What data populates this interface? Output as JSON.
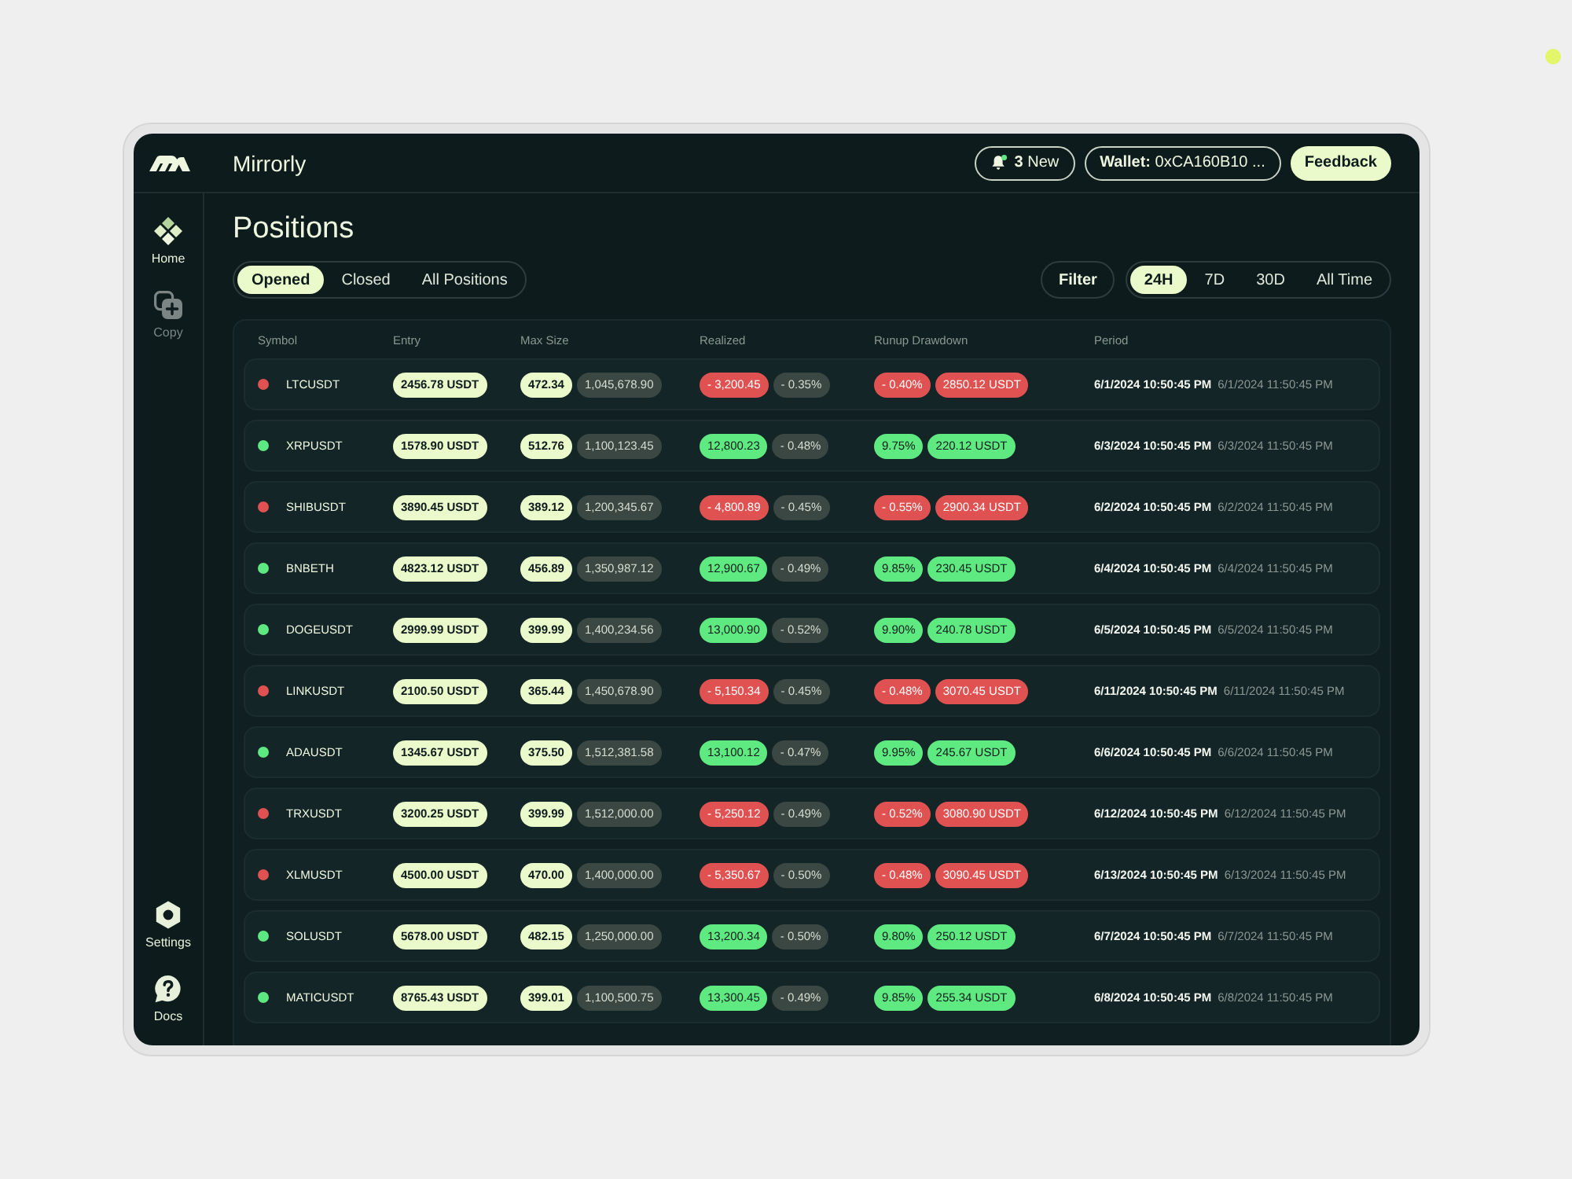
{
  "app": {
    "name": "Mirrorly"
  },
  "header": {
    "notifications": "**3** New",
    "wallet": "**Wallet:** 0xCA160B10 ...",
    "feedback": "Feedback"
  },
  "sidebar": {
    "items": [
      {
        "label": "Home",
        "disabled": false
      },
      {
        "label": "Copy",
        "disabled": true
      }
    ],
    "bottom_items": [
      {
        "label": "Settings",
        "disabled": false
      },
      {
        "label": "Docs",
        "disabled": false
      }
    ]
  },
  "page": {
    "title": "Positions"
  },
  "tabs": [
    {
      "label": "Opened",
      "selected": true
    },
    {
      "label": "Closed",
      "selected": false
    },
    {
      "label": "All Positions",
      "selected": false
    }
  ],
  "filter": "Filter",
  "ranges": [
    {
      "label": "24H",
      "selected": true
    },
    {
      "label": "7D",
      "selected": false
    },
    {
      "label": "30D",
      "selected": false
    },
    {
      "label": "All Time",
      "selected": false
    }
  ],
  "table": {
    "columns": [
      "Symbol",
      "Entry",
      "Max Size",
      "Realized",
      "Runup Drawdown",
      "Period"
    ],
    "rows": [
      {
        "symbol": "LTCUSDT",
        "color": "#e05252",
        "kind": "loss",
        "entry": "2456.78 USDT",
        "max_size": [
          "472.34",
          "1,045,678.90"
        ],
        "realized": [
          "- 3,200.45",
          "- 0.35%"
        ],
        "runup_drawdown": [
          "- 0.40%",
          "2850.12 USDT"
        ],
        "period": [
          "6/1/2024 10:50:45 PM",
          "6/1/2024 11:50:45 PM"
        ]
      },
      {
        "symbol": "XRPUSDT",
        "color": "#5ee882",
        "kind": "profit",
        "entry": "1578.90 USDT",
        "max_size": [
          "512.76",
          "1,100,123.45"
        ],
        "realized": [
          "12,800.23",
          "- 0.48%"
        ],
        "runup_drawdown": [
          "9.75%",
          "220.12 USDT"
        ],
        "period": [
          "6/3/2024 10:50:45 PM",
          "6/3/2024 11:50:45 PM"
        ]
      },
      {
        "symbol": "SHIBUSDT",
        "color": "#e05252",
        "kind": "loss",
        "entry": "3890.45 USDT",
        "max_size": [
          "389.12",
          "1,200,345.67"
        ],
        "realized": [
          "- 4,800.89",
          "- 0.45%"
        ],
        "runup_drawdown": [
          "- 0.55%",
          "2900.34 USDT"
        ],
        "period": [
          "6/2/2024 10:50:45 PM",
          "6/2/2024 11:50:45 PM"
        ]
      },
      {
        "symbol": "BNBETH",
        "color": "#5ee882",
        "kind": "profit",
        "entry": "4823.12 USDT",
        "max_size": [
          "456.89",
          "1,350,987.12"
        ],
        "realized": [
          "12,900.67",
          "- 0.49%"
        ],
        "runup_drawdown": [
          "9.85%",
          "230.45 USDT"
        ],
        "period": [
          "6/4/2024 10:50:45 PM",
          "6/4/2024 11:50:45 PM"
        ]
      },
      {
        "symbol": "DOGEUSDT",
        "color": "#5ee882",
        "kind": "profit",
        "entry": "2999.99 USDT",
        "max_size": [
          "399.99",
          "1,400,234.56"
        ],
        "realized": [
          "13,000.90",
          "- 0.52%"
        ],
        "runup_drawdown": [
          "9.90%",
          "240.78 USDT"
        ],
        "period": [
          "6/5/2024 10:50:45 PM",
          "6/5/2024 11:50:45 PM"
        ]
      },
      {
        "symbol": "LINKUSDT",
        "color": "#e05252",
        "kind": "loss",
        "entry": "2100.50 USDT",
        "max_size": [
          "365.44",
          "1,450,678.90"
        ],
        "realized": [
          "- 5,150.34",
          "- 0.45%"
        ],
        "runup_drawdown": [
          "- 0.48%",
          "3070.45 USDT"
        ],
        "period": [
          "6/11/2024 10:50:45 PM",
          "6/11/2024 11:50:45 PM"
        ]
      },
      {
        "symbol": "ADAUSDT",
        "color": "#5ee882",
        "kind": "profit",
        "entry": "1345.67 USDT",
        "max_size": [
          "375.50",
          "1,512,381.58"
        ],
        "realized": [
          "13,100.12",
          "- 0.47%"
        ],
        "runup_drawdown": [
          "9.95%",
          "245.67 USDT"
        ],
        "period": [
          "6/6/2024 10:50:45 PM",
          "6/6/2024 11:50:45 PM"
        ]
      },
      {
        "symbol": "TRXUSDT",
        "color": "#e05252",
        "kind": "loss",
        "entry": "3200.25 USDT",
        "max_size": [
          "399.99",
          "1,512,000.00"
        ],
        "realized": [
          "- 5,250.12",
          "- 0.49%"
        ],
        "runup_drawdown": [
          "- 0.52%",
          "3080.90 USDT"
        ],
        "period": [
          "6/12/2024 10:50:45 PM",
          "6/12/2024 11:50:45 PM"
        ]
      },
      {
        "symbol": "XLMUSDT",
        "color": "#e05252",
        "kind": "loss",
        "entry": "4500.00 USDT",
        "max_size": [
          "470.00",
          "1,400,000.00"
        ],
        "realized": [
          "- 5,350.67",
          "- 0.50%"
        ],
        "runup_drawdown": [
          "- 0.48%",
          "3090.45 USDT"
        ],
        "period": [
          "6/13/2024 10:50:45 PM",
          "6/13/2024 11:50:45 PM"
        ]
      },
      {
        "symbol": "SOLUSDT",
        "color": "#5ee882",
        "kind": "profit",
        "entry": "5678.00 USDT",
        "max_size": [
          "482.15",
          "1,250,000.00"
        ],
        "realized": [
          "13,200.34",
          "- 0.50%"
        ],
        "runup_drawdown": [
          "9.80%",
          "250.12 USDT"
        ],
        "period": [
          "6/7/2024 10:50:45 PM",
          "6/7/2024 11:50:45 PM"
        ]
      },
      {
        "symbol": "MATICUSDT",
        "color": "#5ee882",
        "kind": "profit",
        "entry": "8765.43 USDT",
        "max_size": [
          "399.01",
          "1,100,500.75"
        ],
        "realized": [
          "13,300.45",
          "- 0.49%"
        ],
        "runup_drawdown": [
          "9.85%",
          "255.34 USDT"
        ],
        "period": [
          "6/8/2024 10:50:45 PM",
          "6/8/2024 11:50:45 PM"
        ]
      }
    ]
  }
}
